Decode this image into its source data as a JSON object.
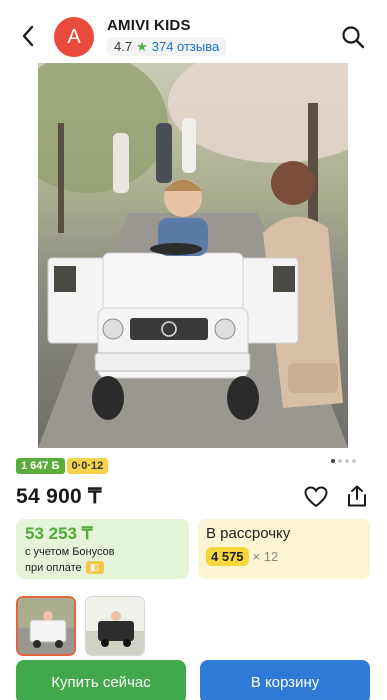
{
  "header": {
    "avatar_letter": "A",
    "shop_name": "AMIVI KIDS",
    "rating": "4.7",
    "reviews": "374 отзыва",
    "star_color": "#45b649"
  },
  "icons": {
    "back": "chevron-left-icon",
    "search": "search-icon",
    "favorite": "heart-icon",
    "share": "share-icon",
    "pay": "wallet-icon"
  },
  "gallery": {
    "image_description": "Child driving white toy Mercedes G-class car with mother",
    "slides": 4,
    "active_slide": 1
  },
  "badges": {
    "bonus": "1 647 Б",
    "installment": "0·0·12"
  },
  "price": {
    "main": "54 900 ₸"
  },
  "bonus_card": {
    "price": "53 253 ₸",
    "line1": "с учетом Бонусов",
    "line2": "при оплате"
  },
  "installment_card": {
    "title": "В рассрочку",
    "amount": "4 575",
    "term": "× 12"
  },
  "actions": {
    "buy_now": "Купить сейчас",
    "add_to_cart": "В корзину"
  },
  "colors": {
    "buy_button": "#41a94b",
    "cart_button": "#2f7ad6",
    "bonus_green": "#55a93b",
    "accent_yellow": "#f7d73a",
    "avatar_red": "#e84a3c"
  }
}
